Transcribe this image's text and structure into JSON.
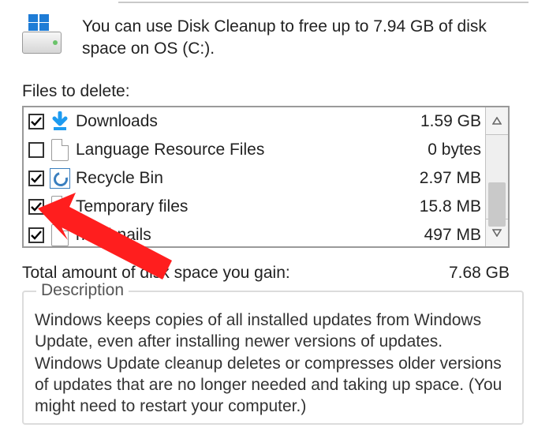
{
  "intro": "You can use Disk Cleanup to free up to 7.94 GB of disk space on OS (C:).",
  "files_label": "Files to delete:",
  "rows": [
    {
      "checked": true,
      "icon": "download",
      "label": "Downloads",
      "size": "1.59 GB"
    },
    {
      "checked": false,
      "icon": "file",
      "label": "Language Resource Files",
      "size": "0 bytes"
    },
    {
      "checked": true,
      "icon": "recycle",
      "label": "Recycle Bin",
      "size": "2.97 MB"
    },
    {
      "checked": true,
      "icon": "file",
      "label": "Temporary files",
      "size": "15.8 MB"
    },
    {
      "checked": true,
      "icon": "file",
      "label": "humbnails",
      "size": "497 MB"
    }
  ],
  "total_label": "Total amount of disk space you gain:",
  "total_value": "7.68 GB",
  "description_title": "Description",
  "description_body": "Windows keeps copies of all installed updates from Windows Update, even after installing newer versions of updates. Windows Update cleanup deletes or compresses older versions of updates that are no longer needed and taking up space. (You might need to restart your computer.)"
}
